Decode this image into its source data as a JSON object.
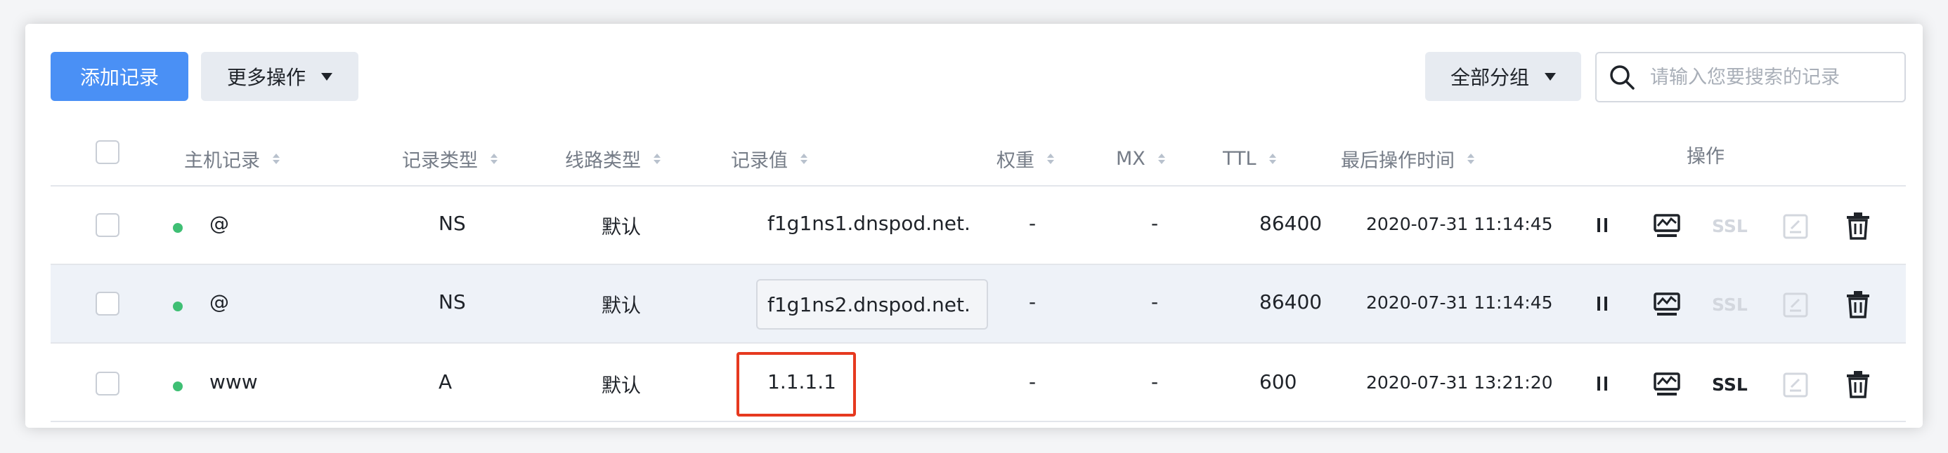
{
  "toolbar": {
    "add_label": "添加记录",
    "more_label": "更多操作",
    "group_label": "全部分组",
    "search_placeholder": "请输入您要搜索的记录"
  },
  "columns": {
    "host": "主机记录",
    "type": "记录类型",
    "line": "线路类型",
    "value": "记录值",
    "weight": "权重",
    "mx": "MX",
    "ttl": "TTL",
    "time": "最后操作时间",
    "actions": "操作"
  },
  "rows": [
    {
      "status": "enabled",
      "host": "@",
      "type": "NS",
      "line": "默认",
      "value": "f1g1ns1.dnspod.net.",
      "weight": "-",
      "mx": "-",
      "ttl": "86400",
      "time": "2020-07-31 11:14:45",
      "ssl": "SSL",
      "ssl_enabled": false
    },
    {
      "status": "enabled",
      "host": "@",
      "type": "NS",
      "line": "默认",
      "value": "f1g1ns2.dnspod.net.",
      "weight": "-",
      "mx": "-",
      "ttl": "86400",
      "time": "2020-07-31 11:14:45",
      "ssl": "SSL",
      "ssl_enabled": false
    },
    {
      "status": "enabled",
      "host": "www",
      "type": "A",
      "line": "默认",
      "value": "1.1.1.1",
      "weight": "-",
      "mx": "-",
      "ttl": "600",
      "time": "2020-07-31 13:21:20",
      "ssl": "SSL",
      "ssl_enabled": true
    }
  ],
  "icons": [
    "pause-icon",
    "monitor-icon",
    "ssl-label",
    "edit-icon",
    "trash-icon"
  ],
  "colors": {
    "primary": "#4a90f5",
    "enabled_dot": "#3fbf74",
    "highlight_border": "#e6391f",
    "row_hover": "#eef2f8"
  }
}
